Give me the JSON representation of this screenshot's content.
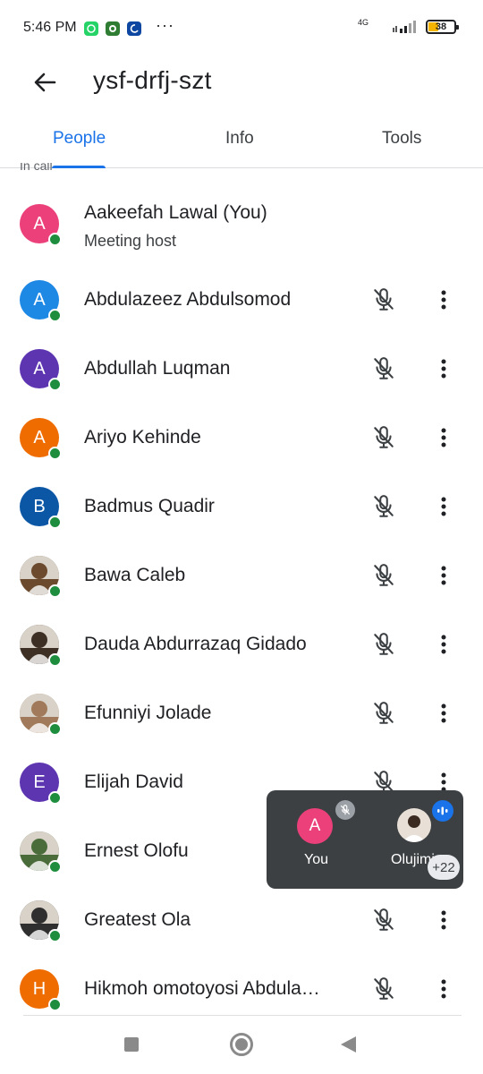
{
  "status_bar": {
    "time": "5:46 PM",
    "network": "4G",
    "battery": "38",
    "battery_level_percent": 38,
    "more": "···"
  },
  "header": {
    "back_icon": "arrow-left-icon",
    "title": "ysf-drfj-szt"
  },
  "tabs": [
    {
      "label": "People",
      "active": true
    },
    {
      "label": "Info",
      "active": false
    },
    {
      "label": "Tools",
      "active": false
    }
  ],
  "section_label": "In call",
  "participants": [
    {
      "initial": "A",
      "name": "Aakeefah Lawal (You)",
      "subtitle": "Meeting host",
      "avatar_color": "#ec407a",
      "online": true
    },
    {
      "initial": "A",
      "name": "Abdulazeez Abdulsomod",
      "avatar_color": "#1e88e5",
      "online": true,
      "muted": true
    },
    {
      "initial": "A",
      "name": "Abdullah Luqman",
      "avatar_color": "#5e35b1",
      "online": true,
      "muted": true
    },
    {
      "initial": "A",
      "name": "Ariyo Kehinde",
      "avatar_color": "#ef6c00",
      "online": true,
      "muted": true
    },
    {
      "initial": "B",
      "name": "Badmus Quadir",
      "avatar_color": "#0b57a5",
      "online": true,
      "muted": true
    },
    {
      "initial": "",
      "name": "Bawa Caleb",
      "avatar_color": "#6b4a2e",
      "photo": true,
      "online": true,
      "muted": true
    },
    {
      "initial": "",
      "name": "Dauda Abdurrazaq Gidado",
      "avatar_color": "#3e2f25",
      "photo": true,
      "online": true,
      "muted": true
    },
    {
      "initial": "",
      "name": "Efunniyi Jolade",
      "avatar_color": "#a07a5a",
      "photo": true,
      "online": true,
      "muted": true
    },
    {
      "initial": "E",
      "name": "Elijah David",
      "avatar_color": "#5e35b1",
      "online": true,
      "muted": true
    },
    {
      "initial": "",
      "name": "Ernest Olofu",
      "avatar_color": "#4a6b3a",
      "photo": true,
      "online": true,
      "muted": false
    },
    {
      "initial": "",
      "name": "Greatest Ola",
      "avatar_color": "#2f2f2f",
      "photo": true,
      "online": true,
      "muted": true
    },
    {
      "initial": "H",
      "name": "Hikmoh omotoyosi Abdula…",
      "avatar_color": "#ef6c00",
      "online": true,
      "muted": true
    }
  ],
  "floating_panel": {
    "you_initial": "A",
    "you_label": "You",
    "other_label": "Olujimi",
    "more_count": "+22"
  },
  "nav_bar": {
    "recents_icon": "square-icon",
    "home_icon": "circle-home-icon",
    "back_icon": "triangle-back-icon"
  },
  "colors": {
    "accent": "#1a73e8",
    "online": "#1e8e3e",
    "panel_bg": "#3c4043"
  }
}
